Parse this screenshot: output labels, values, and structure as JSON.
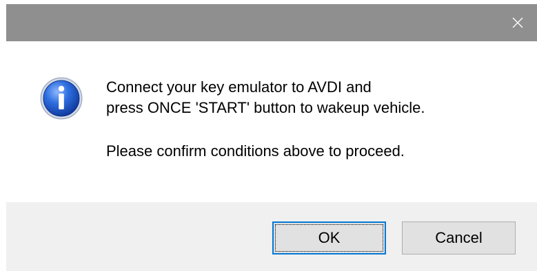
{
  "titlebar": {
    "close_icon": "close-icon"
  },
  "message": {
    "icon": "info-icon",
    "line1": "Connect your key emulator to AVDI and",
    "line2": "press ONCE 'START' button to wakeup vehicle.",
    "line3": "Please confirm conditions above to proceed."
  },
  "buttons": {
    "ok_label": "OK",
    "cancel_label": "Cancel"
  },
  "colors": {
    "titlebar": "#8f8f8f",
    "footer": "#f0f0f0",
    "button_face": "#e1e1e1",
    "default_button_border": "#0078d7",
    "info_icon_blue": "#1f57c8"
  }
}
